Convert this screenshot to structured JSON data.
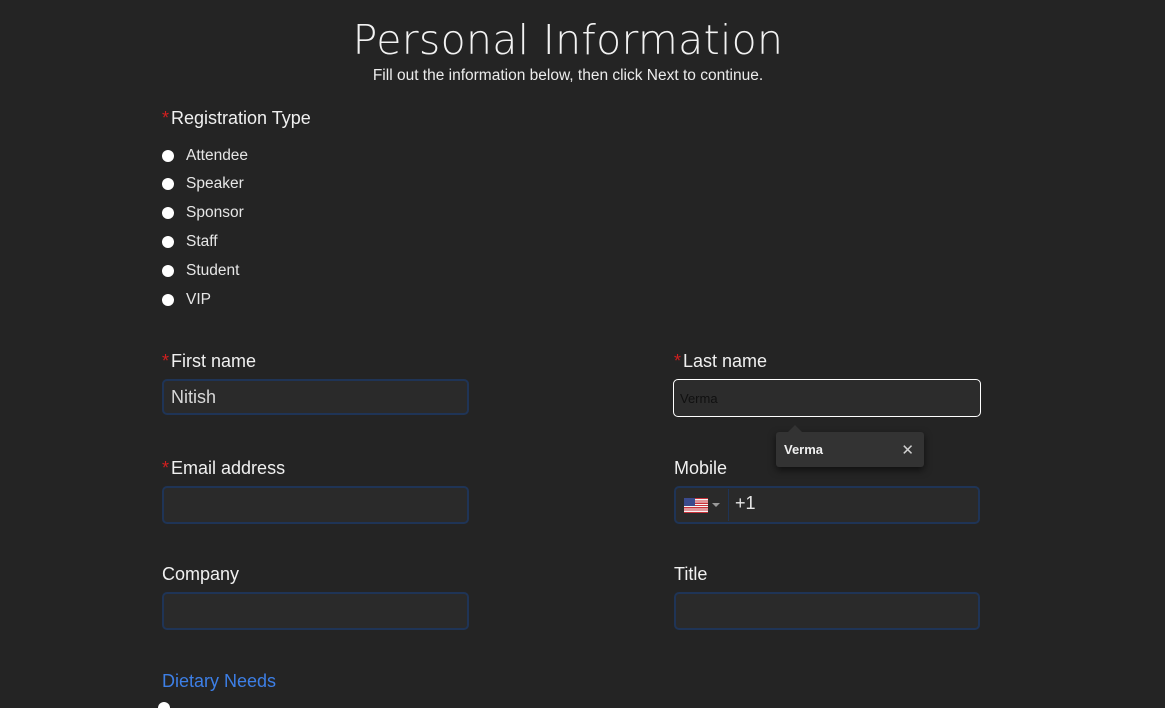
{
  "header": {
    "title": "Personal Information",
    "subtitle": "Fill out the information below, then click Next to continue."
  },
  "registration": {
    "label": "Registration Type",
    "required_mark": "*",
    "options": [
      "Attendee",
      "Speaker",
      "Sponsor",
      "Staff",
      "Student",
      "VIP"
    ]
  },
  "fields": {
    "first_name": {
      "label": "First name",
      "required_mark": "*",
      "value": "Nitish"
    },
    "last_name": {
      "label": "Last name",
      "required_mark": "*",
      "value": "Verma"
    },
    "email": {
      "label": "Email address",
      "required_mark": "*",
      "value": ""
    },
    "mobile": {
      "label": "Mobile",
      "dial_code": "+1",
      "country_flag": "us-flag-icon",
      "value": ""
    },
    "company": {
      "label": "Company",
      "value": ""
    },
    "title": {
      "label": "Title",
      "value": ""
    }
  },
  "autofill": {
    "suggestion": "Verma",
    "close_icon": "✕"
  },
  "dietary": {
    "label": "Dietary Needs"
  },
  "colors": {
    "background": "#242424",
    "required": "#d11f1f",
    "link": "#3d7fe6",
    "input_border": "#1f3456"
  }
}
